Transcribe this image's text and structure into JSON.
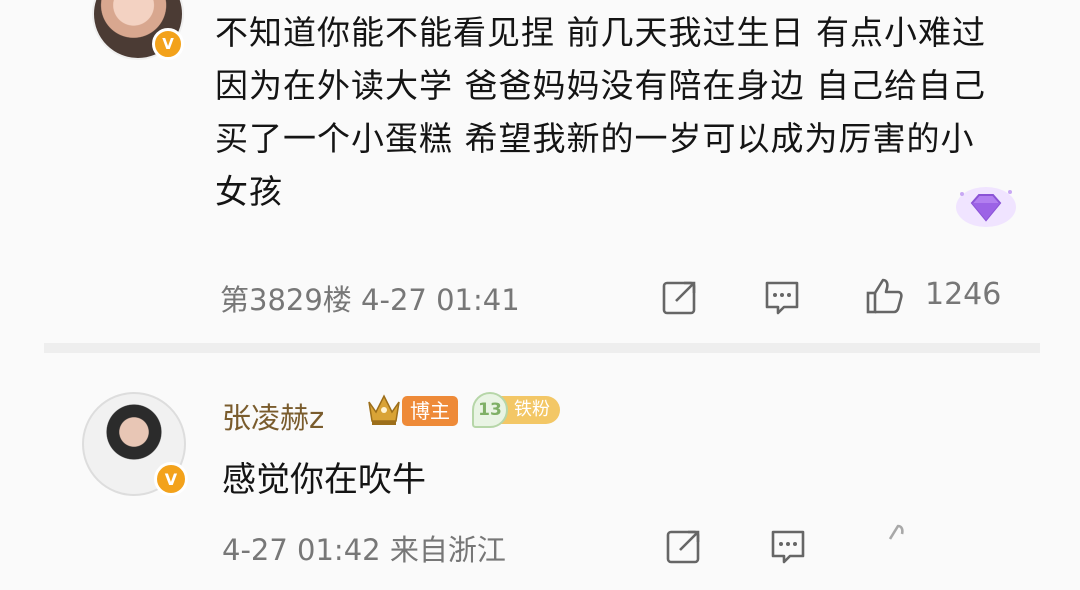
{
  "comments": [
    {
      "text": "不知道你能不能看见捏 前几天我过生日 有点小难过因为在外读大学 爸爸妈妈没有陪在身边 自己给自己买了一个小蛋糕 希望我新的一岁可以成为厉害的小女孩",
      "verified_badge": "V",
      "floor": "第3829楼",
      "time": "4-27 01:41",
      "like_count": "1246",
      "icons": [
        "share-icon",
        "reply-icon",
        "like-icon",
        "diamond-gem-icon"
      ]
    },
    {
      "username": "张凌赫z",
      "verified_badge": "V",
      "blogger_tag": "博主",
      "fan_level": "13",
      "fan_tag": "铁粉",
      "text": "感觉你在吹牛",
      "time": "4-27 01:42",
      "location": "来自浙江",
      "icons": [
        "share-icon",
        "reply-icon",
        "like-icon",
        "crown-icon"
      ]
    }
  ],
  "colors": {
    "username": "#7a5c2d",
    "blogger_tag": "#ee8a38",
    "fan_tag": "#f3c766",
    "verified_badge": "#f3a21b"
  }
}
